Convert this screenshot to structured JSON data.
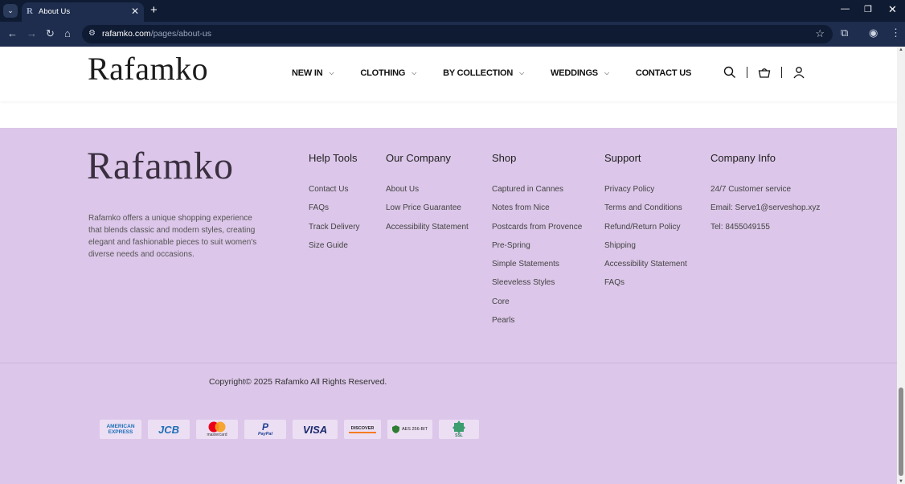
{
  "browser": {
    "tab_title": "About Us",
    "url_host": "rafamko.com",
    "url_path": "/pages/about-us"
  },
  "site": {
    "logo": "Rafamko",
    "nav": [
      {
        "label": "NEW IN",
        "has_dropdown": true
      },
      {
        "label": "CLOTHING",
        "has_dropdown": true
      },
      {
        "label": "BY COLLECTION",
        "has_dropdown": true
      },
      {
        "label": "WEDDINGS",
        "has_dropdown": true
      },
      {
        "label": "CONTACT US",
        "has_dropdown": false
      }
    ],
    "header_icons": [
      "search-icon",
      "cart-icon",
      "account-icon"
    ]
  },
  "footer": {
    "logo": "Rafamko",
    "description": "Rafamko offers a unique shopping experience that blends classic and modern styles, creating elegant and fashionable pieces to suit women's diverse needs and occasions.",
    "columns": [
      {
        "title": "Help Tools",
        "links": [
          "Contact Us",
          "FAQs",
          "Track Delivery",
          "Size Guide"
        ]
      },
      {
        "title": "Our Company",
        "links": [
          "About Us",
          "Low Price Guarantee",
          "Accessibility Statement"
        ]
      },
      {
        "title": "Shop",
        "links": [
          "Captured in Cannes",
          "Notes from Nice",
          "Postcards from Provence",
          "Pre-Spring",
          "Simple Statements",
          "Sleeveless Styles",
          "Core",
          "Pearls"
        ]
      },
      {
        "title": "Support",
        "links": [
          "Privacy Policy",
          "Terms and Conditions",
          "Refund/Return Policy",
          "Shipping",
          "Accessibility Statement",
          "FAQs"
        ]
      },
      {
        "title": "Company Info",
        "links": [
          "24/7 Customer service",
          "Email: Serve1@serveshop.xyz",
          "Tel: 8455049155"
        ]
      }
    ],
    "copyright": "Copyright© 2025 Rafamko All Rights Reserved.",
    "payment_badges": [
      {
        "name": "amex",
        "text_top": "AMERICAN",
        "text_bottom": "EXPRESS"
      },
      {
        "name": "jcb",
        "text": "JCB"
      },
      {
        "name": "mastercard",
        "text": "mastercard"
      },
      {
        "name": "paypal",
        "text": "PayPal"
      },
      {
        "name": "visa",
        "text": "VISA"
      },
      {
        "name": "discover",
        "text": "DISCOVER"
      },
      {
        "name": "aes",
        "text": "AES 256-BIT"
      },
      {
        "name": "ssl",
        "text": "SSL"
      }
    ]
  },
  "colors": {
    "footer_bg": "#dcc6e9",
    "chrome_dark": "#0f1b33",
    "chrome_bar": "#1e2d4d"
  }
}
